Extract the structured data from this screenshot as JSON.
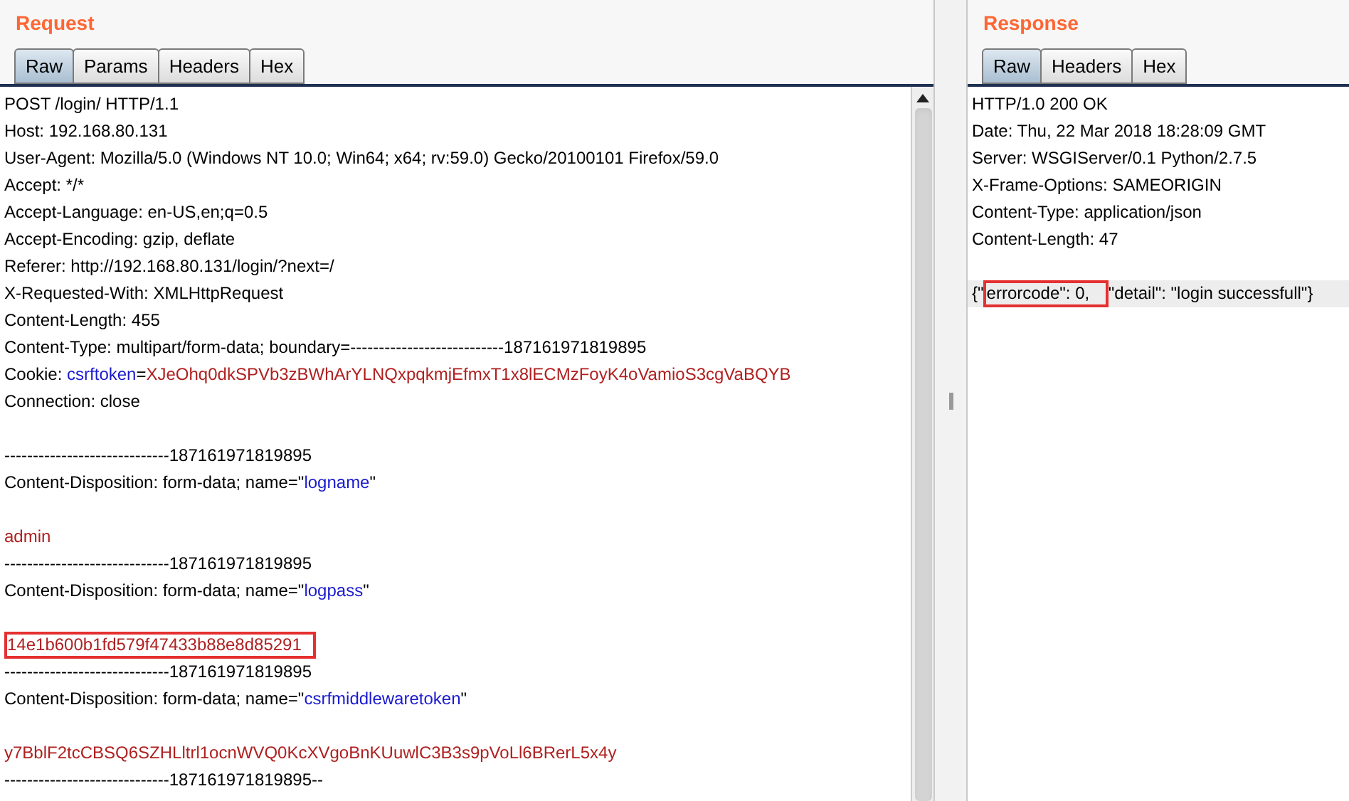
{
  "panes": [
    {
      "title": "Request",
      "tabs": [
        {
          "label": "Raw",
          "selected": true
        },
        {
          "label": "Params",
          "selected": false
        },
        {
          "label": "Headers",
          "selected": false
        },
        {
          "label": "Hex",
          "selected": false
        }
      ],
      "scrollbar": true,
      "lines": [
        {
          "segments": [
            {
              "text": "POST /login/ HTTP/1.1",
              "kind": "plain"
            }
          ]
        },
        {
          "segments": [
            {
              "text": "Host: 192.168.80.131",
              "kind": "plain"
            }
          ]
        },
        {
          "segments": [
            {
              "text": "User-Agent: Mozilla/5.0 (Windows NT 10.0; Win64; x64; rv:59.0) Gecko/20100101 Firefox/59.0",
              "kind": "plain"
            }
          ]
        },
        {
          "segments": [
            {
              "text": "Accept: */*",
              "kind": "plain"
            }
          ]
        },
        {
          "segments": [
            {
              "text": "Accept-Language: en-US,en;q=0.5",
              "kind": "plain"
            }
          ]
        },
        {
          "segments": [
            {
              "text": "Accept-Encoding: gzip, deflate",
              "kind": "plain"
            }
          ]
        },
        {
          "segments": [
            {
              "text": "Referer: http://192.168.80.131/login/?next=/",
              "kind": "plain"
            }
          ]
        },
        {
          "segments": [
            {
              "text": "X-Requested-With: XMLHttpRequest",
              "kind": "plain"
            }
          ]
        },
        {
          "segments": [
            {
              "text": "Content-Length: 455",
              "kind": "plain"
            }
          ]
        },
        {
          "segments": [
            {
              "text": "Content-Type: multipart/form-data; boundary=---------------------------187161971819895",
              "kind": "plain"
            }
          ]
        },
        {
          "segments": [
            {
              "text": "Cookie: ",
              "kind": "plain"
            },
            {
              "text": "csrftoken",
              "kind": "name"
            },
            {
              "text": "=",
              "kind": "plain"
            },
            {
              "text": "XJeOhq0dkSPVb3zBWhArYLNQxpqkmjEfmxT1x8lECMzFoyK4oVamioS3cgVaBQYB",
              "kind": "value"
            }
          ]
        },
        {
          "segments": [
            {
              "text": "Connection: close",
              "kind": "plain"
            }
          ]
        },
        {
          "kind": "blank"
        },
        {
          "segments": [
            {
              "text": "-----------------------------187161971819895",
              "kind": "plain"
            }
          ]
        },
        {
          "segments": [
            {
              "text": "Content-Disposition: form-data; name=\"",
              "kind": "plain"
            },
            {
              "text": "logname",
              "kind": "name"
            },
            {
              "text": "\"",
              "kind": "plain"
            }
          ]
        },
        {
          "kind": "blank"
        },
        {
          "segments": [
            {
              "text": "admin",
              "kind": "value"
            }
          ]
        },
        {
          "segments": [
            {
              "text": "-----------------------------187161971819895",
              "kind": "plain"
            }
          ]
        },
        {
          "segments": [
            {
              "text": "Content-Disposition: form-data; name=\"",
              "kind": "plain"
            },
            {
              "text": "logpass",
              "kind": "name"
            },
            {
              "text": "\"",
              "kind": "plain"
            }
          ]
        },
        {
          "kind": "blank"
        },
        {
          "segments": [
            {
              "text": "14e1b600b1fd579f47433b88e8d85291",
              "kind": "value",
              "boxed": true
            }
          ]
        },
        {
          "segments": [
            {
              "text": "-----------------------------187161971819895",
              "kind": "plain"
            }
          ]
        },
        {
          "segments": [
            {
              "text": "Content-Disposition: form-data; name=\"",
              "kind": "plain"
            },
            {
              "text": "csrfmiddlewaretoken",
              "kind": "name"
            },
            {
              "text": "\"",
              "kind": "plain"
            }
          ]
        },
        {
          "kind": "blank"
        },
        {
          "segments": [
            {
              "text": "y7BblF2tcCBSQ6SZHLltrl1ocnWVQ0KcXVgoBnKUuwlC3B3s9pVoLl6BRerL5x4y",
              "kind": "value"
            }
          ]
        },
        {
          "segments": [
            {
              "text": "-----------------------------187161971819895--",
              "kind": "plain"
            }
          ]
        }
      ]
    },
    {
      "title": "Response",
      "tabs": [
        {
          "label": "Raw",
          "selected": true
        },
        {
          "label": "Headers",
          "selected": false
        },
        {
          "label": "Hex",
          "selected": false
        }
      ],
      "scrollbar": false,
      "lines": [
        {
          "segments": [
            {
              "text": "HTTP/1.0 200 OK",
              "kind": "plain"
            }
          ]
        },
        {
          "segments": [
            {
              "text": "Date: Thu, 22 Mar 2018 18:28:09 GMT",
              "kind": "plain"
            }
          ]
        },
        {
          "segments": [
            {
              "text": "Server: WSGIServer/0.1 Python/2.7.5",
              "kind": "plain"
            }
          ]
        },
        {
          "segments": [
            {
              "text": "X-Frame-Options: SAMEORIGIN",
              "kind": "plain"
            }
          ]
        },
        {
          "segments": [
            {
              "text": "Content-Type: application/json",
              "kind": "plain"
            }
          ]
        },
        {
          "segments": [
            {
              "text": "Content-Length: 47",
              "kind": "plain"
            }
          ]
        },
        {
          "kind": "blank"
        },
        {
          "current": true,
          "segments": [
            {
              "text": "{\"",
              "kind": "plain"
            },
            {
              "text": "errorcode\": 0, ",
              "kind": "plain",
              "boxed": true
            },
            {
              "text": "\"detail\": \"login successfull\"}",
              "kind": "plain"
            }
          ]
        }
      ]
    }
  ]
}
